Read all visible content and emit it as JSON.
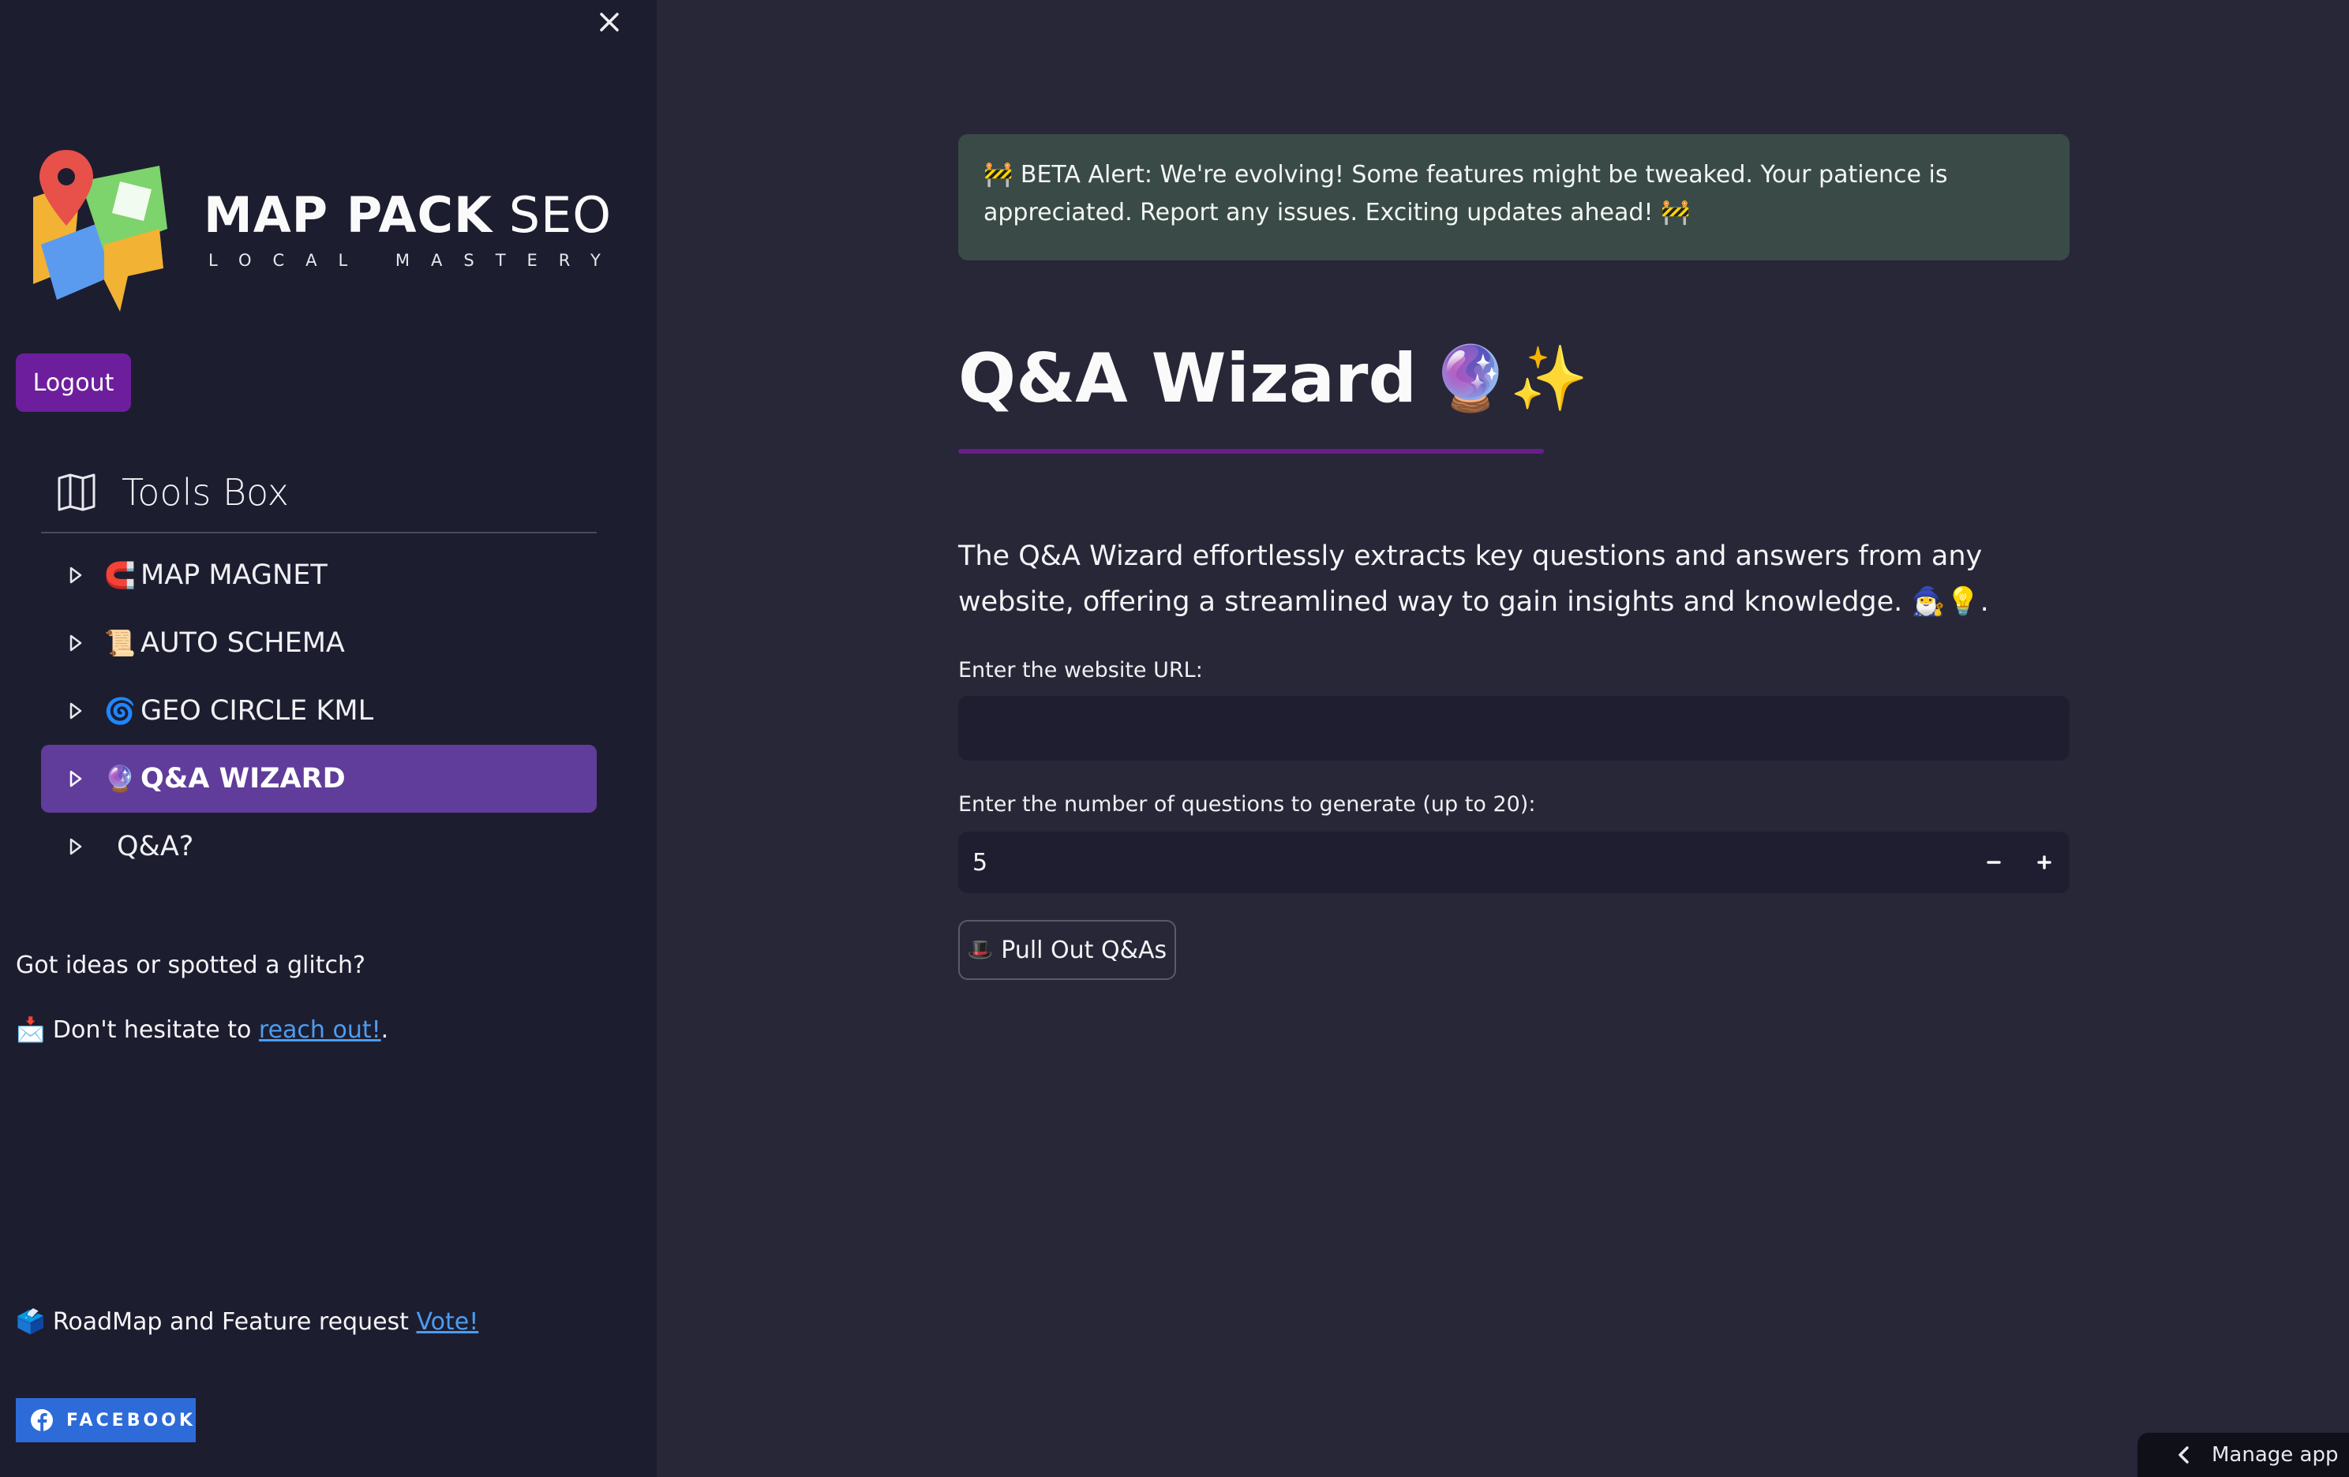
{
  "colors": {
    "sidebar_bg": "#1d1d30",
    "main_bg": "#272738",
    "accent_purple": "#6d1e9c",
    "active_nav": "#603d9a",
    "alert_bg": "#3a4b47",
    "link": "#4c9df0",
    "facebook": "#2d6bd8"
  },
  "sidebar": {
    "close_icon": "close-icon",
    "logo": {
      "title_bold": "MAP PACK",
      "title_light": "SEO",
      "subtitle": "LOCAL MASTERY"
    },
    "logout_label": "Logout",
    "toolsbox": {
      "icon": "map-icon",
      "title": "Tools Box",
      "items": [
        {
          "emoji": "🧲",
          "label": "MAP MAGNET",
          "active": false
        },
        {
          "emoji": "📜",
          "label": "AUTO SCHEMA",
          "active": false
        },
        {
          "emoji": "🌀",
          "label": "GEO CIRCLE KML",
          "active": false
        },
        {
          "emoji": "🔮",
          "label": "Q&A WIZARD",
          "active": true
        },
        {
          "emoji": "",
          "label": "Q&A?",
          "active": false
        }
      ]
    },
    "feedback": {
      "question": "Got ideas or spotted a glitch?",
      "cta_prefix": "📩 Don't hesitate to ",
      "cta_link": "reach out!",
      "cta_suffix": "."
    },
    "roadmap": {
      "prefix": "🗳️ RoadMap and Feature request ",
      "link": "Vote!"
    },
    "facebook_label": "FACEBOOK"
  },
  "main": {
    "alert": "🚧 BETA Alert: We're evolving! Some features might be tweaked. Your patience is appreciated. Report any issues. Exciting updates ahead! 🚧",
    "title": "Q&A Wizard",
    "title_emoji": "🔮✨",
    "description": "The Q&A Wizard effortlessly extracts key questions and answers from any website, offering a streamlined way to gain insights and knowledge. 🧙‍♂️💡.",
    "url_label": "Enter the website URL:",
    "url_value": "",
    "count_label": "Enter the number of questions to generate (up to 20):",
    "count_value": "5",
    "pull_button_emoji": "🎩",
    "pull_button_label": "Pull Out Q&As",
    "manage_app": "Manage app"
  }
}
